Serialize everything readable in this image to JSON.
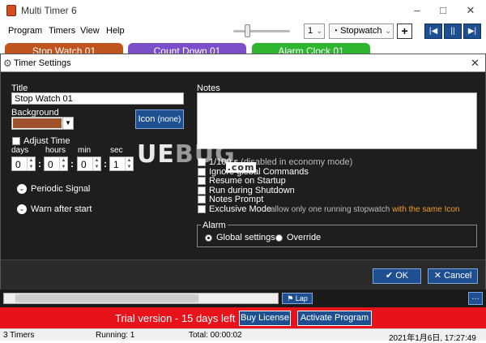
{
  "window": {
    "title": "Multi Timer 6",
    "minimize": "–",
    "maximize": "□",
    "close": "✕"
  },
  "menu": [
    "Program",
    "Timers",
    "View",
    "Help"
  ],
  "toolbar": {
    "count_value": "1",
    "type_value": "Stopwatch",
    "add": "+",
    "nav": [
      "|◀",
      "||",
      "▶|"
    ]
  },
  "timer_tabs": [
    {
      "label": "Stop Watch 01",
      "color": "#c0541f"
    },
    {
      "label": "Count Down 01",
      "color": "#7a4fc8"
    },
    {
      "label": "Alarm Clock 01",
      "color": "#2fb52f"
    }
  ],
  "dialog": {
    "title": "Timer Settings",
    "title_label": "Title",
    "title_value": "Stop Watch 01",
    "background_label": "Background",
    "background_color": "#a0522d",
    "icon_button": "Icon",
    "icon_value": "(none)",
    "adjust_time_label": "Adjust Time",
    "time_units": [
      "days",
      "hours",
      "min",
      "sec"
    ],
    "time_values": [
      "0",
      "0",
      "0",
      "1"
    ],
    "periodic_signal": "Periodic Signal",
    "warn_after_start": "Warn after start",
    "notes_label": "Notes",
    "options": [
      {
        "label": "1/100 s",
        "note": "(disabled in economy mode)"
      },
      {
        "label": "Ignore global Commands"
      },
      {
        "label": "Resume on Startup"
      },
      {
        "label": "Run during Shutdown"
      },
      {
        "label": "Notes Prompt"
      },
      {
        "label": "Exclusive Mode",
        "note": "allow only one running stopwatch",
        "highlight": "with the same Icon"
      }
    ],
    "alarm_label": "Alarm",
    "alarm_options": [
      "Global settings",
      "Override"
    ],
    "ok_label": "OK",
    "cancel_label": "Cancel",
    "accent_highlight": "#f0a020"
  },
  "watermark": {
    "text_1": "UE",
    "text_2": "BUG",
    "suffix": ".com"
  },
  "bottom": {
    "lap_label": "Lap",
    "more_label": "…",
    "trial_text": "Trial version - 15 days left",
    "buy_label": "Buy License",
    "activate_label": "Activate Program"
  },
  "status": {
    "timers": "3 Timers",
    "running": "Running: 1",
    "total": "Total: 00:00:02",
    "datetime": "2021年1月6日, 17:27:49"
  }
}
